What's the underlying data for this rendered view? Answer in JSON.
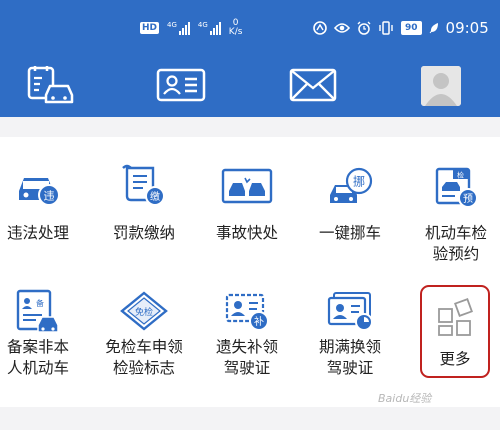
{
  "status_bar": {
    "network_a": "4G",
    "network_b": "4G",
    "speed_value": "0",
    "speed_unit": "K/s",
    "battery": "90",
    "time": "09:05"
  },
  "header_icons": [
    "car-license-icon",
    "id-card-icon",
    "mail-icon",
    "avatar"
  ],
  "services": [
    {
      "label": "违法处理",
      "badge": "违"
    },
    {
      "label": "罚款缴纳",
      "badge": "缴"
    },
    {
      "label": "事故快处",
      "badge": ""
    },
    {
      "label": "一键挪车",
      "badge": "挪"
    },
    {
      "label1": "机动车检",
      "label2": "验预约",
      "badge": "预",
      "tag": "检"
    },
    {
      "label1": "备案非本",
      "label2": "人机动车",
      "badge": "备"
    },
    {
      "label1": "免检车申领",
      "label2": "检验标志",
      "badge": "免检"
    },
    {
      "label1": "遗失补领",
      "label2": "驾驶证",
      "badge": "补"
    },
    {
      "label1": "期满换领",
      "label2": "驾驶证",
      "badge": ""
    },
    {
      "label": "更多",
      "badge": ""
    }
  ],
  "watermark": "Baidu经验",
  "colors": {
    "header": "#2f6dc5",
    "highlight": "#c0221f"
  }
}
